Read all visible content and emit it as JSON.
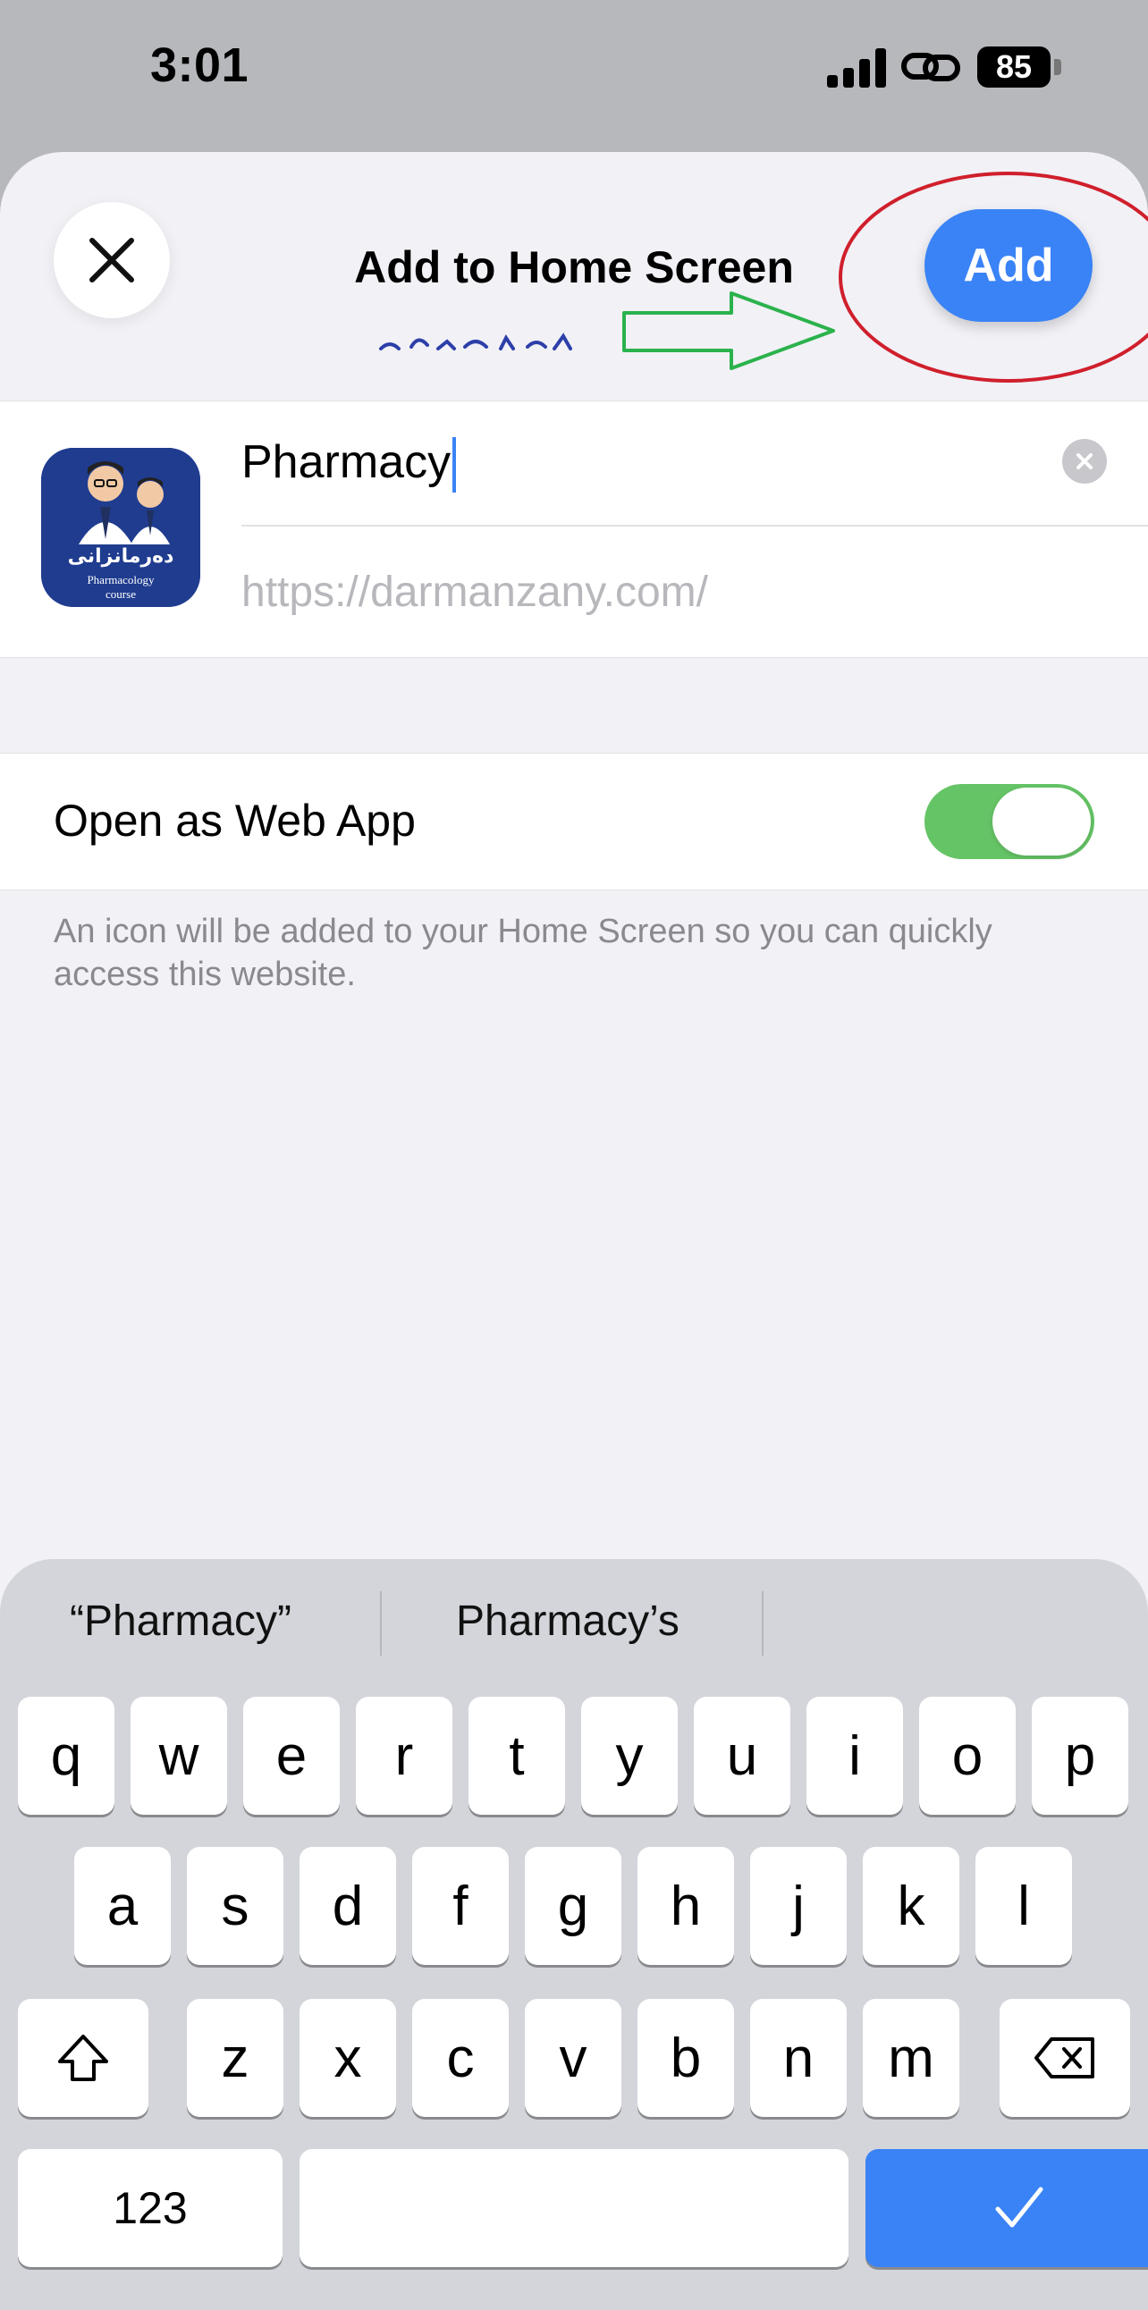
{
  "status_bar": {
    "time": "3:01",
    "battery": "85"
  },
  "sheet": {
    "title": "Add to Home Screen",
    "add_label": "Add"
  },
  "bookmark": {
    "name_value": "Pharmacy",
    "url": "https://darmanzany.com/",
    "icon_text_arabic": "دەرمانزانی",
    "icon_text_en_1": "Pharmacology",
    "icon_text_en_2": "course"
  },
  "web_app": {
    "label": "Open as Web App",
    "enabled": true
  },
  "helper_text": "An icon will be added to your Home Screen so you can quickly access this website.",
  "keyboard": {
    "suggestions": [
      "“Pharmacy”",
      "Pharmacy’s"
    ],
    "row1": [
      "q",
      "w",
      "e",
      "r",
      "t",
      "y",
      "u",
      "i",
      "o",
      "p"
    ],
    "row2": [
      "a",
      "s",
      "d",
      "f",
      "g",
      "h",
      "j",
      "k",
      "l"
    ],
    "row3": [
      "z",
      "x",
      "c",
      "v",
      "b",
      "n",
      "m"
    ],
    "numbers_label": "123"
  },
  "colors": {
    "accent": "#3a83f6",
    "toggle_on": "#65c466",
    "annotation_circle": "#d01f2c",
    "annotation_arrow": "#2bb24c"
  }
}
